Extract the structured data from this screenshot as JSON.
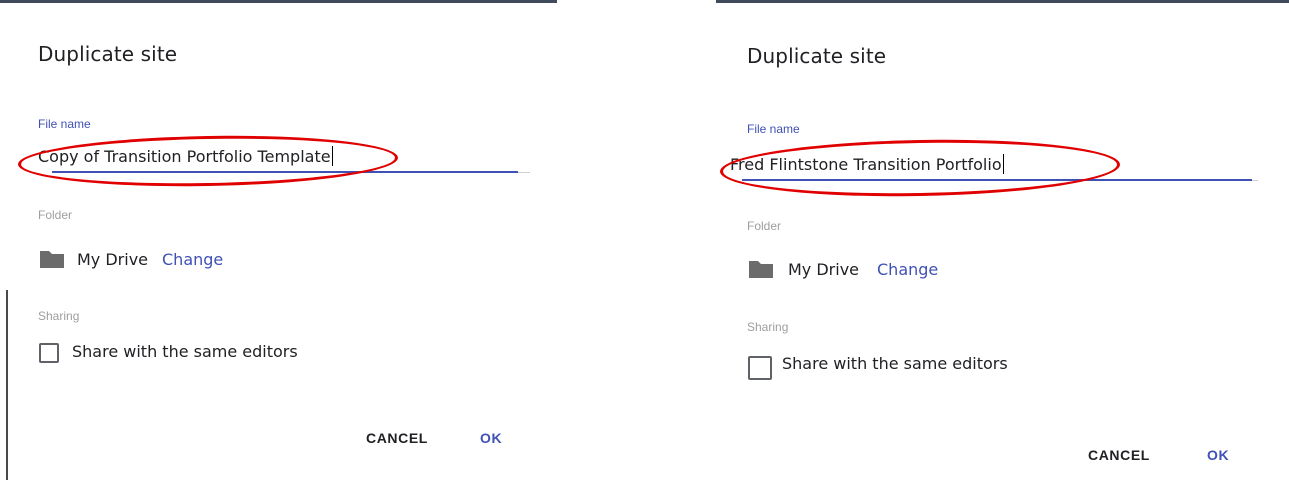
{
  "left_dialog": {
    "title": "Duplicate site",
    "file_name_label": "File name",
    "file_name_value": "Copy of Transition Portfolio Template",
    "folder_label": "Folder",
    "folder_name": "My Drive",
    "change_link": "Change",
    "sharing_label": "Sharing",
    "share_checkbox_label": "Share with the same editors",
    "share_checked": false,
    "cancel_button": "CANCEL",
    "ok_button": "OK"
  },
  "right_dialog": {
    "title": "Duplicate site",
    "file_name_label": "File name",
    "file_name_value": "Fred Flintstone Transition Portfolio",
    "folder_label": "Folder",
    "folder_name": "My Drive",
    "change_link": "Change",
    "sharing_label": "Sharing",
    "share_checkbox_label": "Share with the same editors",
    "share_checked": false,
    "cancel_button": "CANCEL",
    "ok_button": "OK"
  },
  "colors": {
    "accent": "#3f51b5",
    "annotation": "#e00000",
    "icon": "#6b6b6b"
  },
  "icons": [
    "folder-icon"
  ]
}
